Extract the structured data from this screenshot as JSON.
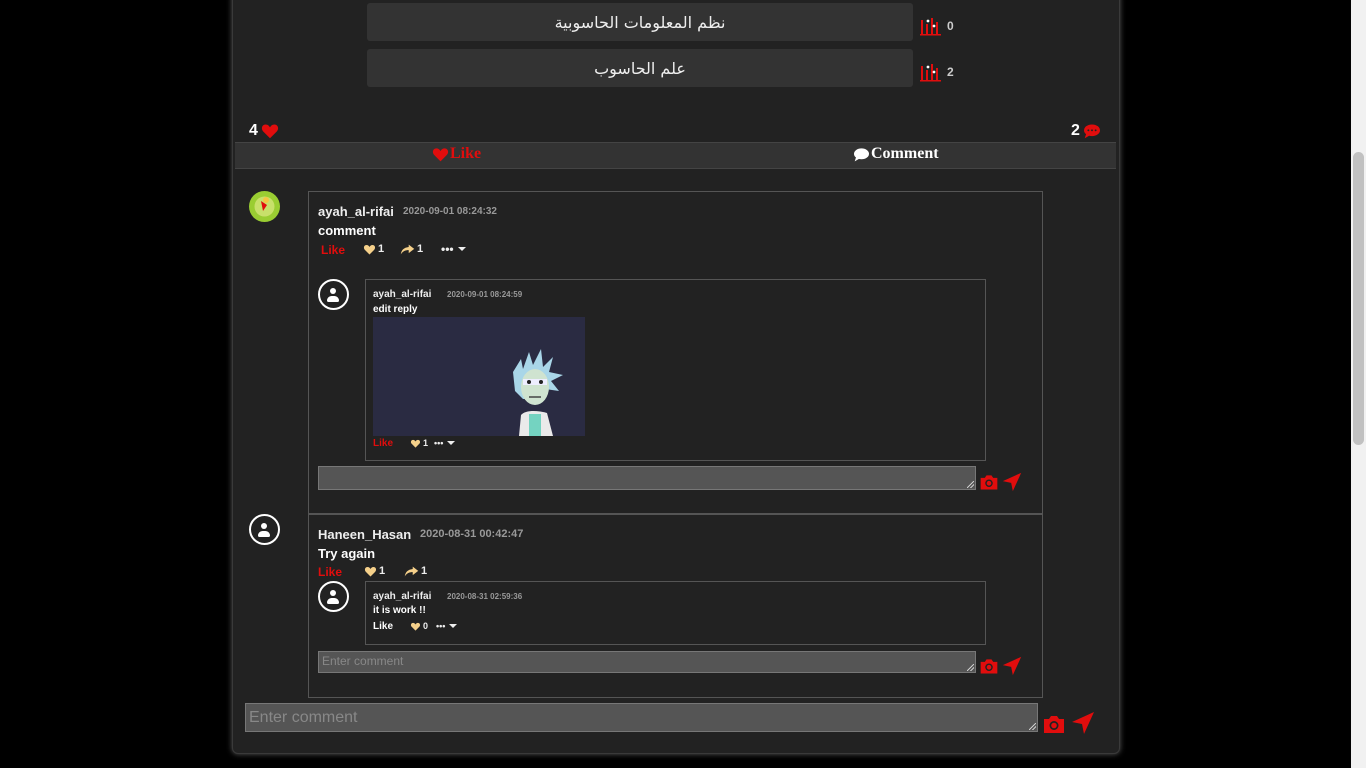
{
  "poll": {
    "options": [
      {
        "label": "نظم المعلومات الحاسوبية",
        "count": "0"
      },
      {
        "label": "علم الحاسوب",
        "count": "2"
      }
    ]
  },
  "post_stats": {
    "likes": "4",
    "comments": "2"
  },
  "actions": {
    "like_label": "Like",
    "comment_label": "Comment"
  },
  "comments": [
    {
      "user": "ayah_al-rifai",
      "timestamp": "2020-09-01 08:24:32",
      "text": "comment",
      "like_label": "Like",
      "likes": "1",
      "shares": "1",
      "reply": {
        "user": "ayah_al-rifai",
        "timestamp": "2020-09-01 08:24:59",
        "text": "edit reply",
        "like_label": "Like",
        "likes": "1"
      },
      "reply_input_placeholder": ""
    },
    {
      "user": "Haneen_Hasan",
      "timestamp": "2020-08-31 00:42:47",
      "text": "Try again",
      "like_label": "Like",
      "likes": "1",
      "shares": "1",
      "reply": {
        "user": "ayah_al-rifai",
        "timestamp": "2020-08-31 02:59:36",
        "text": "it is work !!",
        "like_label": "Like",
        "likes": "0"
      },
      "reply_input_placeholder": "Enter comment"
    }
  ],
  "main_input": {
    "placeholder": "Enter comment"
  },
  "colors": {
    "accent": "#e10d0d",
    "background": "#000000",
    "card": "#222222",
    "reaction_heart": "#f5d08a"
  },
  "icons": {
    "poll_icon": "poll-bars-icon",
    "heart": "heart-icon",
    "comment": "comment-bubble-icon",
    "camera": "camera-icon",
    "send": "send-icon",
    "share": "share-arrow-icon",
    "more": "more-dots-icon"
  }
}
